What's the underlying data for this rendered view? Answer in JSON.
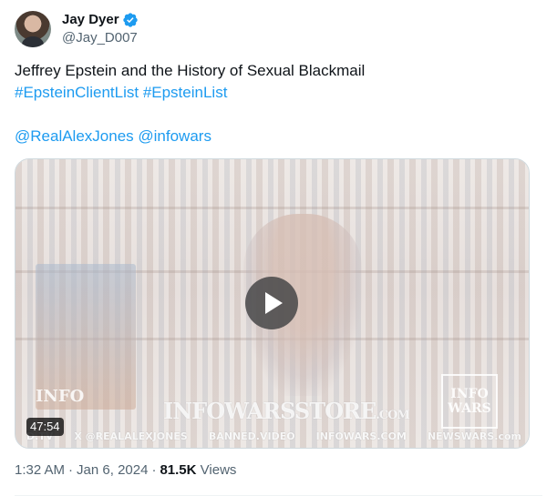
{
  "author": {
    "display_name": "Jay Dyer",
    "handle": "@Jay_D007",
    "verified_color": "#1d9bf0"
  },
  "tweet": {
    "title_line": "Jeffrey Epstein and the History of Sexual Blackmail",
    "hashtags": [
      "#EpsteinClientList",
      "#EpsteinList"
    ],
    "mentions": [
      "@RealAlexJones",
      "@infowars"
    ]
  },
  "media": {
    "duration": "47:54",
    "watermark_main": "INFOWARSSTORE",
    "watermark_suffix": ".COM",
    "logo_left": "INFO",
    "logo_corner": "INFO WARS",
    "ticker": [
      "D.TV",
      "X @REALALEXJONES",
      "BANNED.VIDEO",
      "INFOWARS.COM",
      "NEWSWARS.com"
    ]
  },
  "meta": {
    "time": "1:32 AM",
    "date": "Jan 6, 2024",
    "separator": "·",
    "views_count": "81.5K",
    "views_label": "Views"
  },
  "colors": {
    "link": "#1d9bf0",
    "secondary_text": "#536471",
    "primary_text": "#0f1419",
    "border": "#cfd9de"
  }
}
